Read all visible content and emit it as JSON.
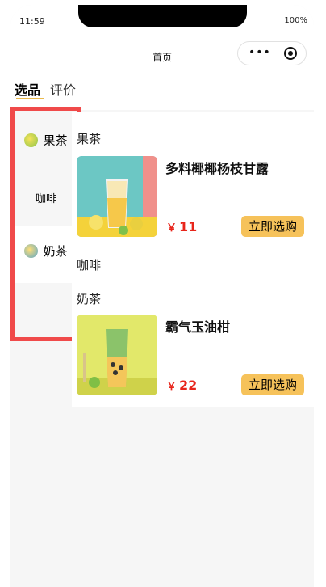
{
  "status": {
    "time": "11:59",
    "battery": "100%"
  },
  "navbar": {
    "title": "首页",
    "menu_icon": "more-dots-icon",
    "close_icon": "capsule-target-icon"
  },
  "tabs": [
    {
      "label": "选品",
      "active": true
    },
    {
      "label": "评价",
      "active": false
    }
  ],
  "sidebar": {
    "items": [
      {
        "label": "果茶",
        "icon": "fruit-tea-icon"
      },
      {
        "label": "咖啡"
      },
      {
        "label": "奶茶",
        "icon": "milk-tea-icon"
      }
    ]
  },
  "main": {
    "sections": [
      {
        "title": "果茶",
        "products": [
          {
            "name": "多料椰椰杨枝甘露",
            "currency": "￥",
            "price": "11",
            "buy_label": "立即选购"
          }
        ]
      },
      {
        "title": "咖啡",
        "products": []
      },
      {
        "title": "奶茶",
        "products": [
          {
            "name": "霸气玉油柑",
            "currency": "￥",
            "price": "22",
            "buy_label": "立即选购"
          }
        ]
      }
    ]
  },
  "colors": {
    "accent": "#f6c25a",
    "price": "#e8251b",
    "highlight": "#f04a4a"
  }
}
